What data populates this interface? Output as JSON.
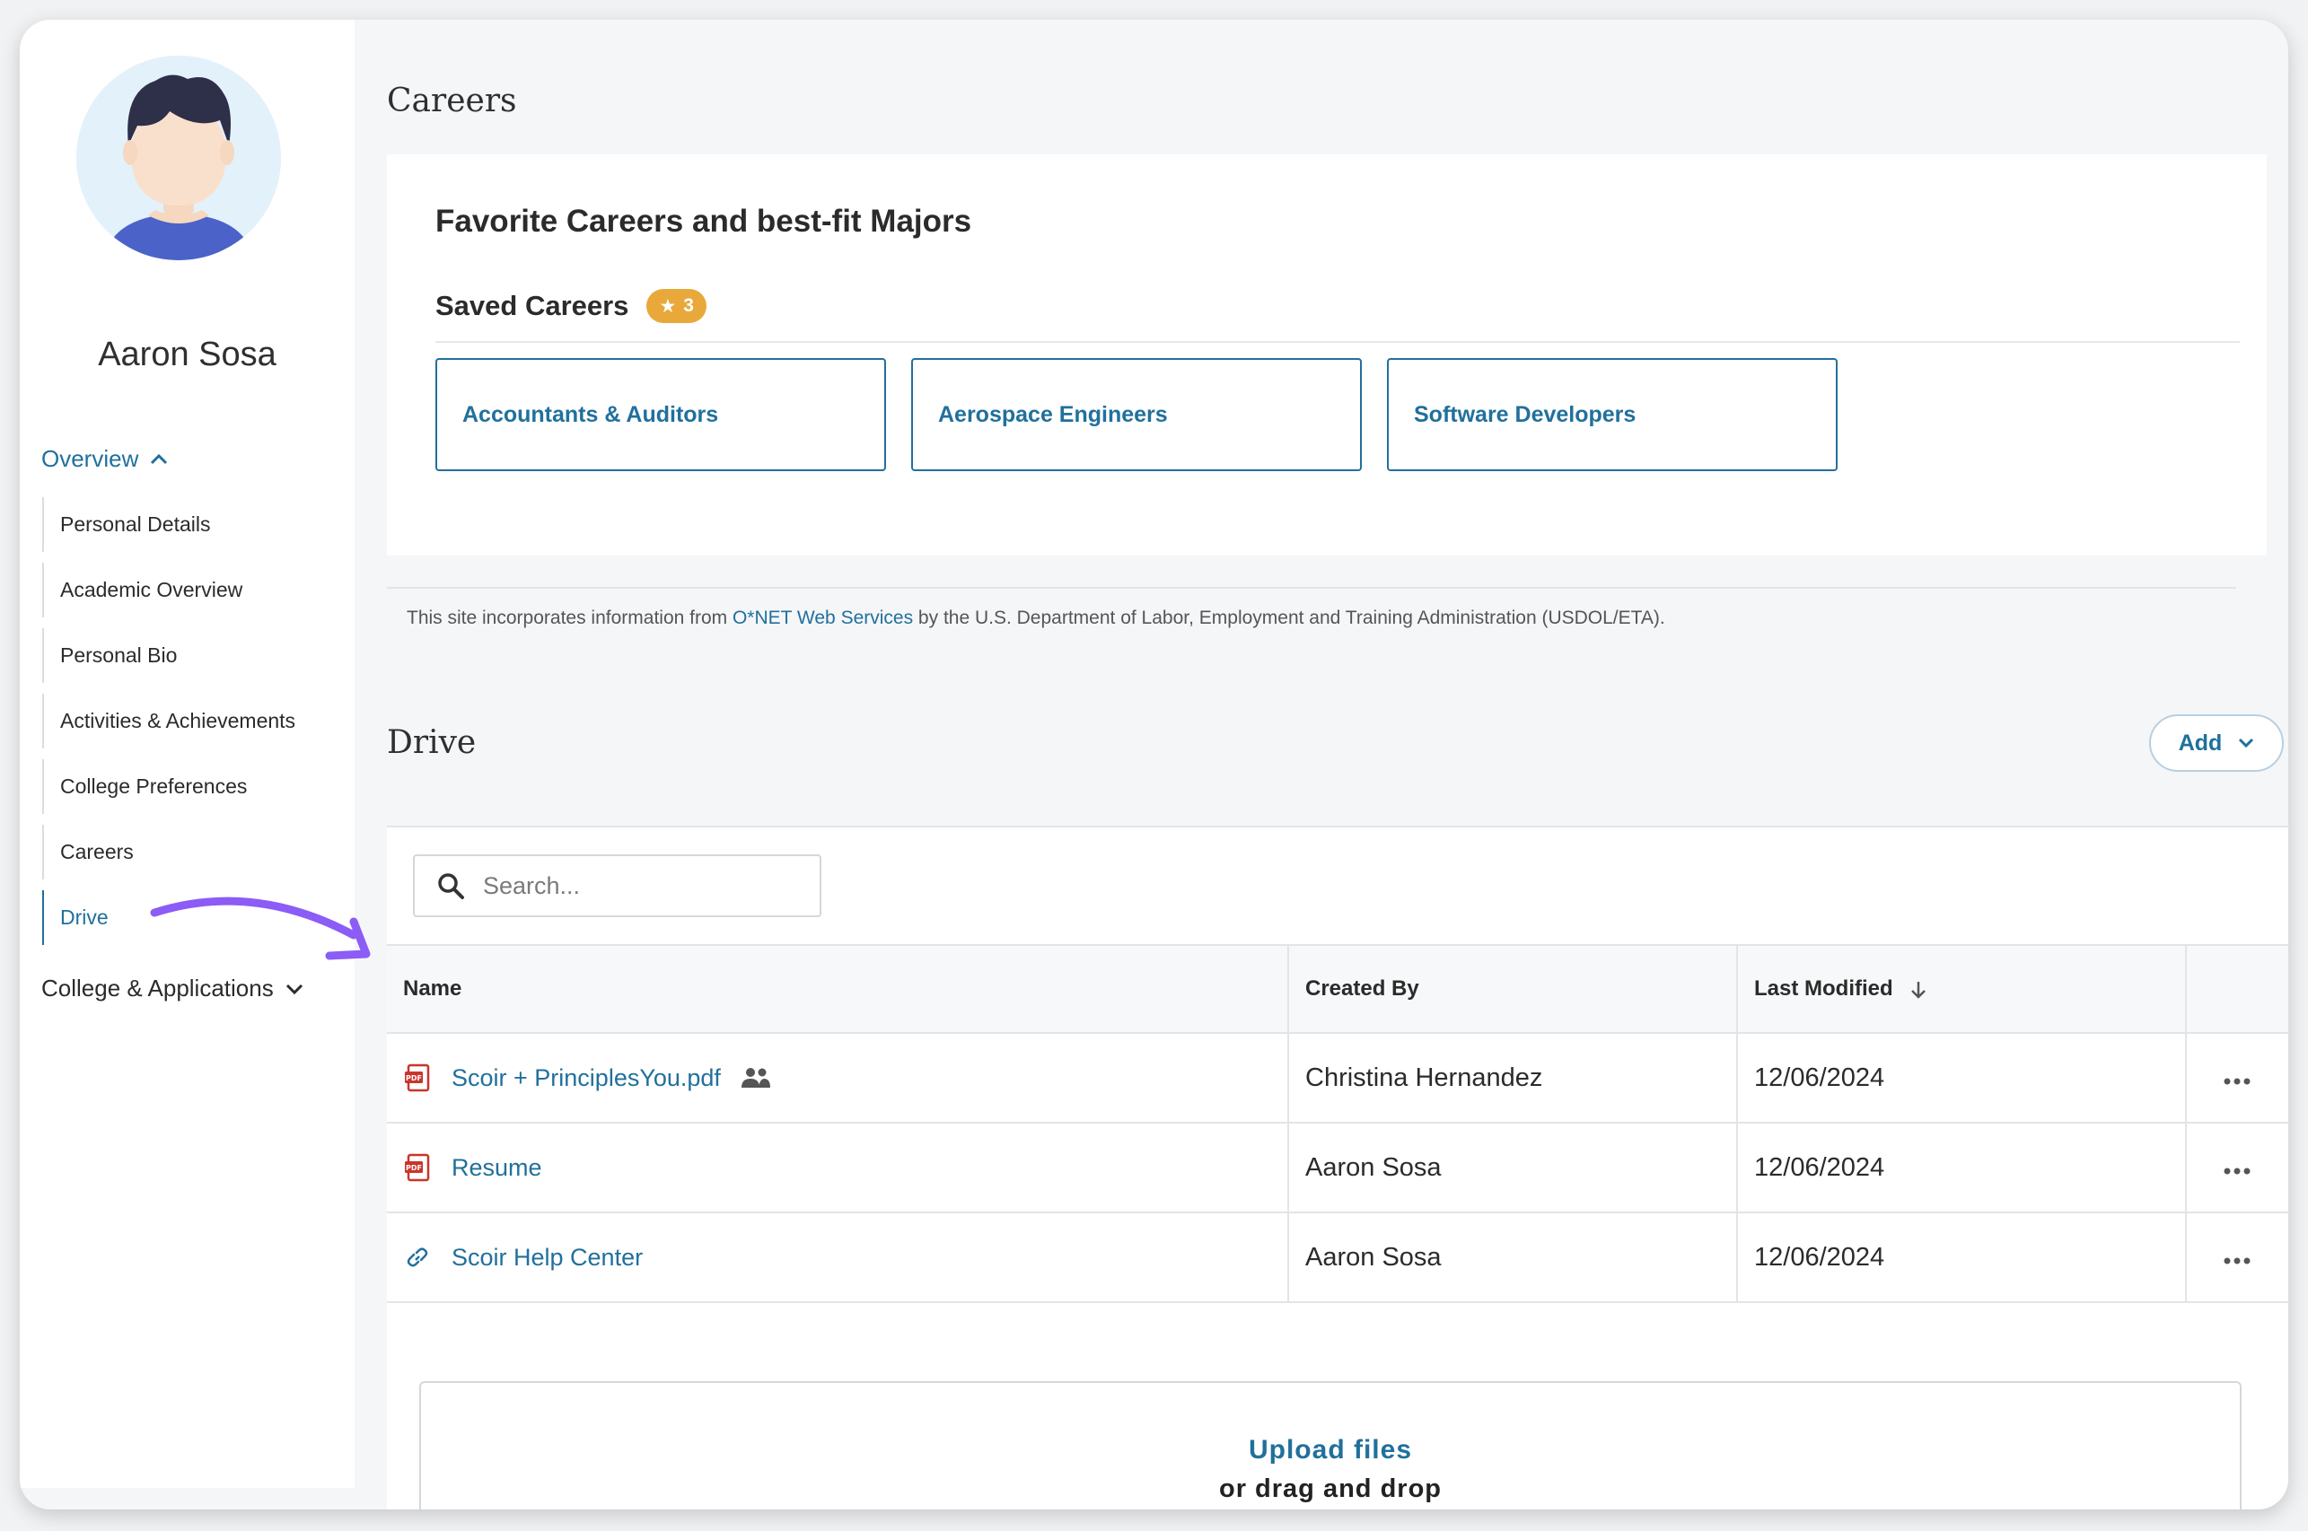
{
  "sidebar": {
    "user_name": "Aaron Sosa",
    "overview_label": "Overview",
    "items": [
      {
        "label": "Personal Details"
      },
      {
        "label": "Academic Overview"
      },
      {
        "label": "Personal Bio"
      },
      {
        "label": "Activities & Achievements"
      },
      {
        "label": "College Preferences"
      },
      {
        "label": "Careers"
      },
      {
        "label": "Drive",
        "active": true
      }
    ],
    "college_label": "College & Applications"
  },
  "careers": {
    "page_title": "Careers",
    "card_heading": "Favorite Careers and best-fit Majors",
    "saved_label": "Saved Careers",
    "saved_count": "3",
    "tiles": [
      "Accountants & Auditors",
      "Aerospace Engineers",
      "Software Developers"
    ],
    "onet_before": "This site incorporates information from ",
    "onet_link": "O*NET Web Services",
    "onet_after": " by the U.S. Department of Labor, Employment and Training Administration (USDOL/ETA)."
  },
  "drive": {
    "title": "Drive",
    "add_label": "Add",
    "search_placeholder": "Search...",
    "columns": {
      "name": "Name",
      "created_by": "Created By",
      "last_modified": "Last Modified"
    },
    "rows": [
      {
        "name": "Scoir + PrinciplesYou.pdf",
        "icon": "pdf-icon",
        "shared": true,
        "created_by": "Christina Hernandez",
        "modified": "12/06/2024"
      },
      {
        "name": "Resume",
        "icon": "pdf-icon",
        "shared": false,
        "created_by": "Aaron Sosa",
        "modified": "12/06/2024"
      },
      {
        "name": "Scoir Help Center",
        "icon": "link-icon",
        "shared": false,
        "created_by": "Aaron Sosa",
        "modified": "12/06/2024"
      }
    ],
    "upload_link": "Upload files",
    "upload_sub": "or drag and drop"
  },
  "colors": {
    "accent": "#21709c",
    "badge": "#e8a93a",
    "arrow": "#8b5cf6",
    "pdf": "#c8352b"
  }
}
